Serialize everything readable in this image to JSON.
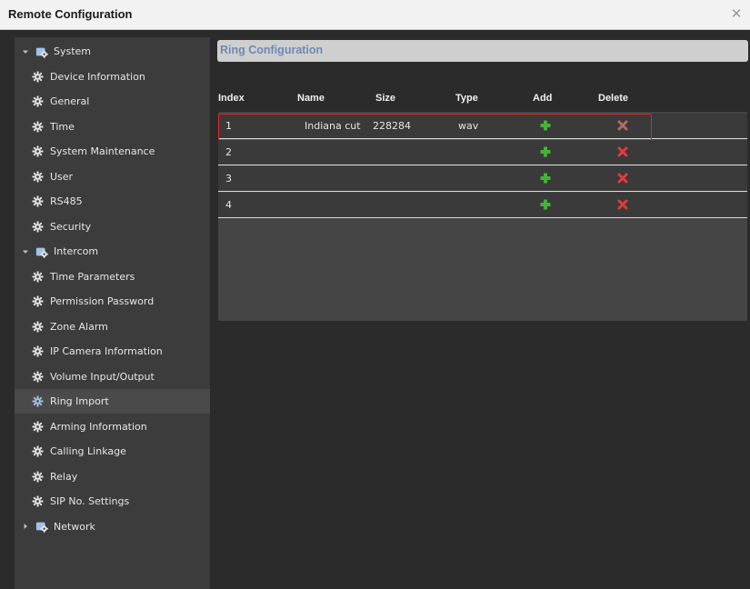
{
  "window": {
    "title": "Remote Configuration",
    "close_icon": "close-icon"
  },
  "sidebar": {
    "groups": [
      {
        "label": "System",
        "expanded": true,
        "items": [
          "Device Information",
          "General",
          "Time",
          "System Maintenance",
          "User",
          "RS485",
          "Security"
        ]
      },
      {
        "label": "Intercom",
        "expanded": true,
        "items": [
          "Time Parameters",
          "Permission Password",
          "Zone Alarm",
          "IP Camera Information",
          "Volume Input/Output",
          "Ring Import",
          "Arming Information",
          "Calling Linkage",
          "Relay",
          "SIP No. Settings"
        ]
      },
      {
        "label": "Network",
        "expanded": false,
        "items": []
      }
    ],
    "selected": "Ring Import"
  },
  "main": {
    "section_title": "Ring Configuration",
    "table": {
      "columns": [
        "Index",
        "Name",
        "Size",
        "Type",
        "Add",
        "Delete"
      ],
      "rows": [
        {
          "index": "1",
          "name": "Indiana cut",
          "size": "228284",
          "type": "wav",
          "delete_enabled": false
        },
        {
          "index": "2",
          "name": "",
          "size": "",
          "type": "",
          "delete_enabled": true
        },
        {
          "index": "3",
          "name": "",
          "size": "",
          "type": "",
          "delete_enabled": true
        },
        {
          "index": "4",
          "name": "",
          "size": "",
          "type": "",
          "delete_enabled": true
        }
      ]
    }
  },
  "colors": {
    "add": "#45b338",
    "delete_enabled": "#e23b3b",
    "delete_disabled": "#b56a6a",
    "highlight": "#e02828",
    "header_text": "#6d8ab2"
  }
}
